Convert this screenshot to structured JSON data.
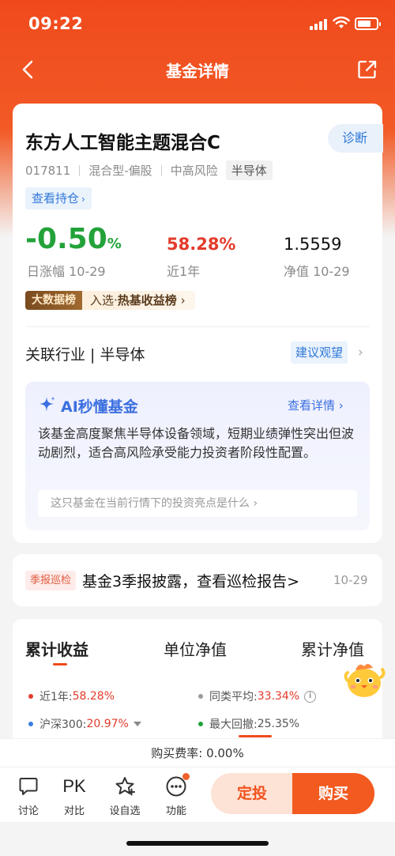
{
  "status_bar": {
    "time": "09:22"
  },
  "nav": {
    "title": "基金详情"
  },
  "fund": {
    "name": "东方人工智能主题混合C",
    "diagnose_label": "诊断",
    "code": "017811",
    "type": "混合型-偏股",
    "risk": "中高风险",
    "sector_tag": "半导体",
    "holdings_label": "查看持仓",
    "daily_change_value": "-0.50",
    "daily_change_unit": "%",
    "daily_change_label": "日涨幅 10-29",
    "one_year_return": "58.28%",
    "one_year_label": "近1年",
    "nav_value": "1.5559",
    "nav_label": "净值 10-29",
    "colors": {
      "down": "#23a23a",
      "up": "#e33b2b",
      "accent": "#f04a1c",
      "link": "#2f78d8"
    }
  },
  "ranking": {
    "badge": "大数据榜",
    "text_prefix": "入选·",
    "text_bold": "热基收益榜"
  },
  "industry": {
    "label": "关联行业 | 半导体",
    "advice_label": "建议观望"
  },
  "ai": {
    "title": "AI秒懂基金",
    "detail_label": "查看详情",
    "summary": "该基金高度聚焦半导体设备领域，短期业绩弹性突出但波动剧烈，适合高风险承受能力投资者阶段性配置。",
    "question": "这只基金在当前行情下的投资亮点是什么"
  },
  "report": {
    "tag": "季报巡检",
    "text": "基金3季报披露，查看巡检报告>",
    "date": "10-29"
  },
  "chart_tabs": [
    {
      "label": "累计收益"
    },
    {
      "label": "单位净值"
    },
    {
      "label": "累计净值"
    }
  ],
  "legend": {
    "one_year_label": "近1年:",
    "one_year_value": "58.28%",
    "peer_avg_label": "同类平均:",
    "peer_avg_value": "33.34%",
    "csi300_label": "沪深300:",
    "csi300_value": "20.97%",
    "max_drawdown_label": "最大回撤:",
    "max_drawdown_value": "25.35%",
    "info_symbol": "i"
  },
  "fee": {
    "text": "购买费率: 0.00%"
  },
  "bottom_nav": [
    {
      "label": "讨论",
      "icon": "chat-icon"
    },
    {
      "label": "对比",
      "icon": "pk-icon",
      "icon_text": "PK"
    },
    {
      "label": "设自选",
      "icon": "star-icon"
    },
    {
      "label": "功能",
      "icon": "more-icon"
    }
  ],
  "actions": {
    "dingtou_label": "定投",
    "buy_label": "购买"
  }
}
